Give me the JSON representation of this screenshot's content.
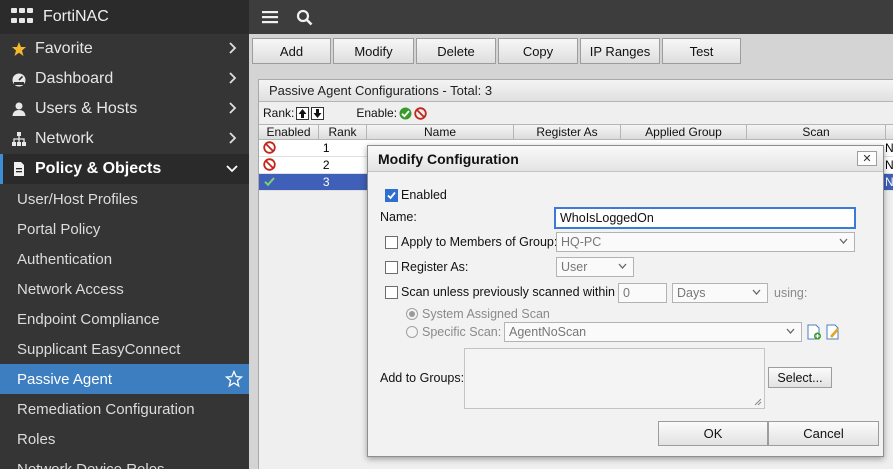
{
  "app": {
    "title": "FortiNAC"
  },
  "sidebar": {
    "groups": [
      {
        "label": "Favorite",
        "icon": "star-icon"
      },
      {
        "label": "Dashboard",
        "icon": "dashboard-icon"
      },
      {
        "label": "Users & Hosts",
        "icon": "user-icon"
      },
      {
        "label": "Network",
        "icon": "network-icon"
      },
      {
        "label": "Policy & Objects",
        "icon": "policy-icon"
      }
    ],
    "sub_items": [
      "User/Host Profiles",
      "Portal Policy",
      "Authentication",
      "Network Access",
      "Endpoint Compliance",
      "Supplicant EasyConnect",
      "Passive Agent",
      "Remediation Configuration",
      "Roles",
      "Network Device Roles"
    ]
  },
  "toolbar": {
    "add": "Add",
    "modify": "Modify",
    "delete": "Delete",
    "copy": "Copy",
    "ip_ranges": "IP Ranges",
    "test": "Test"
  },
  "panel": {
    "title": "Passive Agent Configurations - Total: 3",
    "rank_label": "Rank:",
    "enabled_label": "Enable:",
    "columns": [
      "Enabled",
      "Rank",
      "Name",
      "Register As",
      "Applied Group",
      "Scan"
    ],
    "rows": [
      {
        "enabled": "disabled-icon",
        "rank": "1",
        "tail": "N"
      },
      {
        "enabled": "disabled-icon",
        "rank": "2",
        "tail": "N"
      },
      {
        "enabled": "enabled-icon",
        "rank": "3",
        "tail": "N"
      }
    ]
  },
  "modal": {
    "title": "Modify Configuration",
    "close": "✕",
    "enabled_label": "Enabled",
    "name_label": "Name:",
    "name_value": "WhoIsLoggedOn",
    "apply_group_label": "Apply to Members of Group:",
    "apply_group_value": "HQ-PC",
    "register_as_label": "Register As:",
    "register_as_value": "User",
    "scan_label": "Scan unless previously scanned within",
    "scan_value": "0",
    "scan_unit": "Days",
    "using_label": "using:",
    "system_scan_label": "System Assigned Scan",
    "specific_scan_label": "Specific Scan:",
    "specific_scan_value": "AgentNoScan",
    "add_groups_label": "Add to Groups:",
    "select_button": "Select...",
    "ok_button": "OK",
    "cancel_button": "Cancel"
  },
  "colors": {
    "sidebar_bg": "#353535",
    "selected": "#3c7ec0",
    "row_selected": "#3f5fb8"
  }
}
